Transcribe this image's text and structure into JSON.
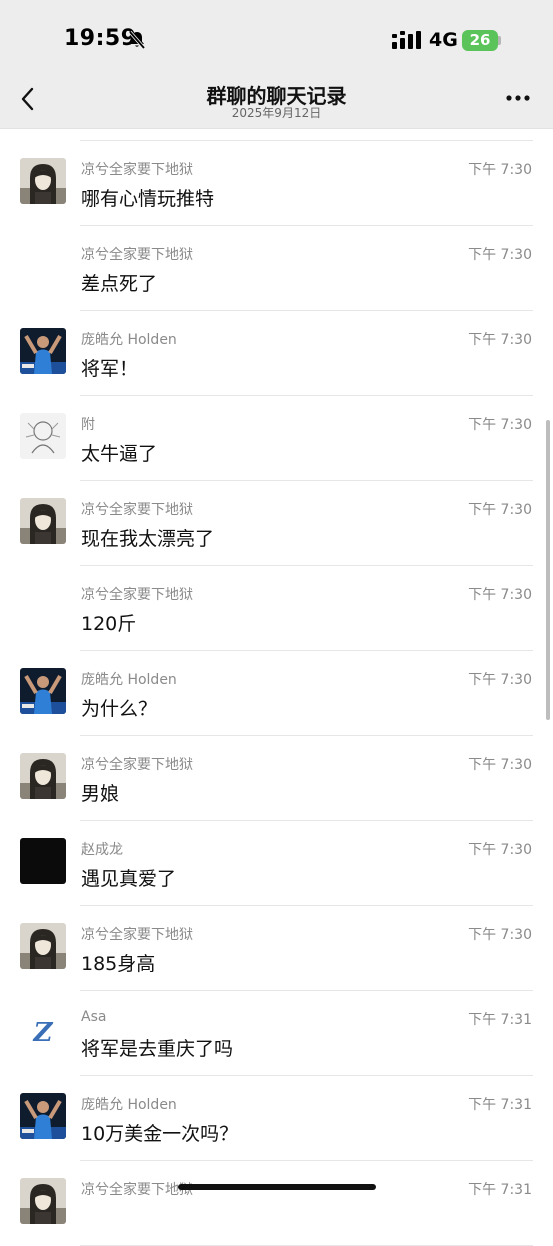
{
  "status_bar": {
    "time": "19:59",
    "network": "4G",
    "battery": "26",
    "icons": [
      "bell-slash-icon",
      "signal-bars-icon",
      "battery-charging-icon"
    ]
  },
  "header": {
    "title": "群聊的聊天记录",
    "subtitle": "2025年9月12日",
    "icons": [
      "back-chevron-icon",
      "more-dots-icon"
    ]
  },
  "messages": [
    {
      "sender": "凉兮全家要下地狱",
      "time": "下午 7:30",
      "text": "哪有心情玩推特",
      "avatar": "anime-girl",
      "show_avatar": true
    },
    {
      "sender": "凉兮全家要下地狱",
      "time": "下午 7:30",
      "text": "差点死了",
      "avatar": "anime-girl",
      "show_avatar": false
    },
    {
      "sender": "庞皓允 Holden",
      "time": "下午 7:30",
      "text": "将军！",
      "avatar": "athlete",
      "show_avatar": true
    },
    {
      "sender": "附",
      "time": "下午 7:30",
      "text": "太牛逼了",
      "avatar": "sketch",
      "show_avatar": true
    },
    {
      "sender": "凉兮全家要下地狱",
      "time": "下午 7:30",
      "text": "现在我太漂亮了",
      "avatar": "anime-girl",
      "show_avatar": true
    },
    {
      "sender": "凉兮全家要下地狱",
      "time": "下午 7:30",
      "text": "120斤",
      "avatar": "anime-girl",
      "show_avatar": false
    },
    {
      "sender": "庞皓允 Holden",
      "time": "下午 7:30",
      "text": "为什么？",
      "avatar": "athlete",
      "show_avatar": true
    },
    {
      "sender": "凉兮全家要下地狱",
      "time": "下午 7:30",
      "text": "男娘",
      "avatar": "anime-girl",
      "show_avatar": true
    },
    {
      "sender": "赵成龙",
      "time": "下午 7:30",
      "text": "遇见真爱了",
      "avatar": "black",
      "show_avatar": true
    },
    {
      "sender": "凉兮全家要下地狱",
      "time": "下午 7:30",
      "text": "185身高",
      "avatar": "anime-girl",
      "show_avatar": true
    },
    {
      "sender": "Asa",
      "time": "下午 7:31",
      "text": "将军是去重庆了吗",
      "avatar": "letter-z",
      "show_avatar": true
    },
    {
      "sender": "庞皓允 Holden",
      "time": "下午 7:31",
      "text": "10万美金一次吗？",
      "avatar": "athlete",
      "show_avatar": true
    },
    {
      "sender": "凉兮全家要下地狱",
      "time": "下午 7:31",
      "text": "",
      "avatar": "anime-girl",
      "show_avatar": true
    }
  ],
  "colors": {
    "bar_bg": "#ededed",
    "battery_green": "#5ac35a",
    "meta_gray": "#8a8a8a"
  }
}
